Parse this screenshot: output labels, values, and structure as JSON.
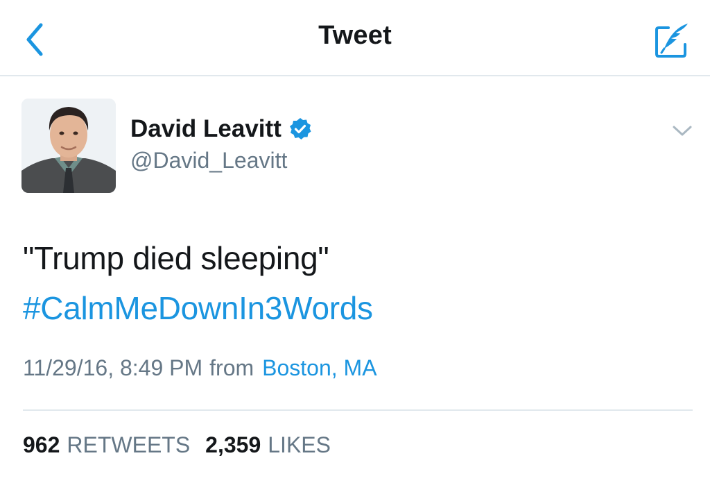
{
  "header": {
    "title": "Tweet",
    "back_icon": "chevron-left-icon",
    "compose_icon": "compose-feather-icon"
  },
  "author": {
    "name": "David Leavitt",
    "handle": "@David_Leavitt",
    "verified": true
  },
  "tweet": {
    "text": "\"Trump died sleeping\"",
    "hashtag": "#CalmMeDownIn3Words",
    "timestamp": "11/29/16, 8:49 PM",
    "from_label": "from",
    "location": "Boston, MA"
  },
  "stats": {
    "retweets_count": "962",
    "retweets_label": "RETWEETS",
    "likes_count": "2,359",
    "likes_label": "LIKES"
  },
  "colors": {
    "accent": "#1b95e0",
    "text": "#14171a",
    "secondary": "#657786",
    "divider": "#e1e8ed"
  }
}
